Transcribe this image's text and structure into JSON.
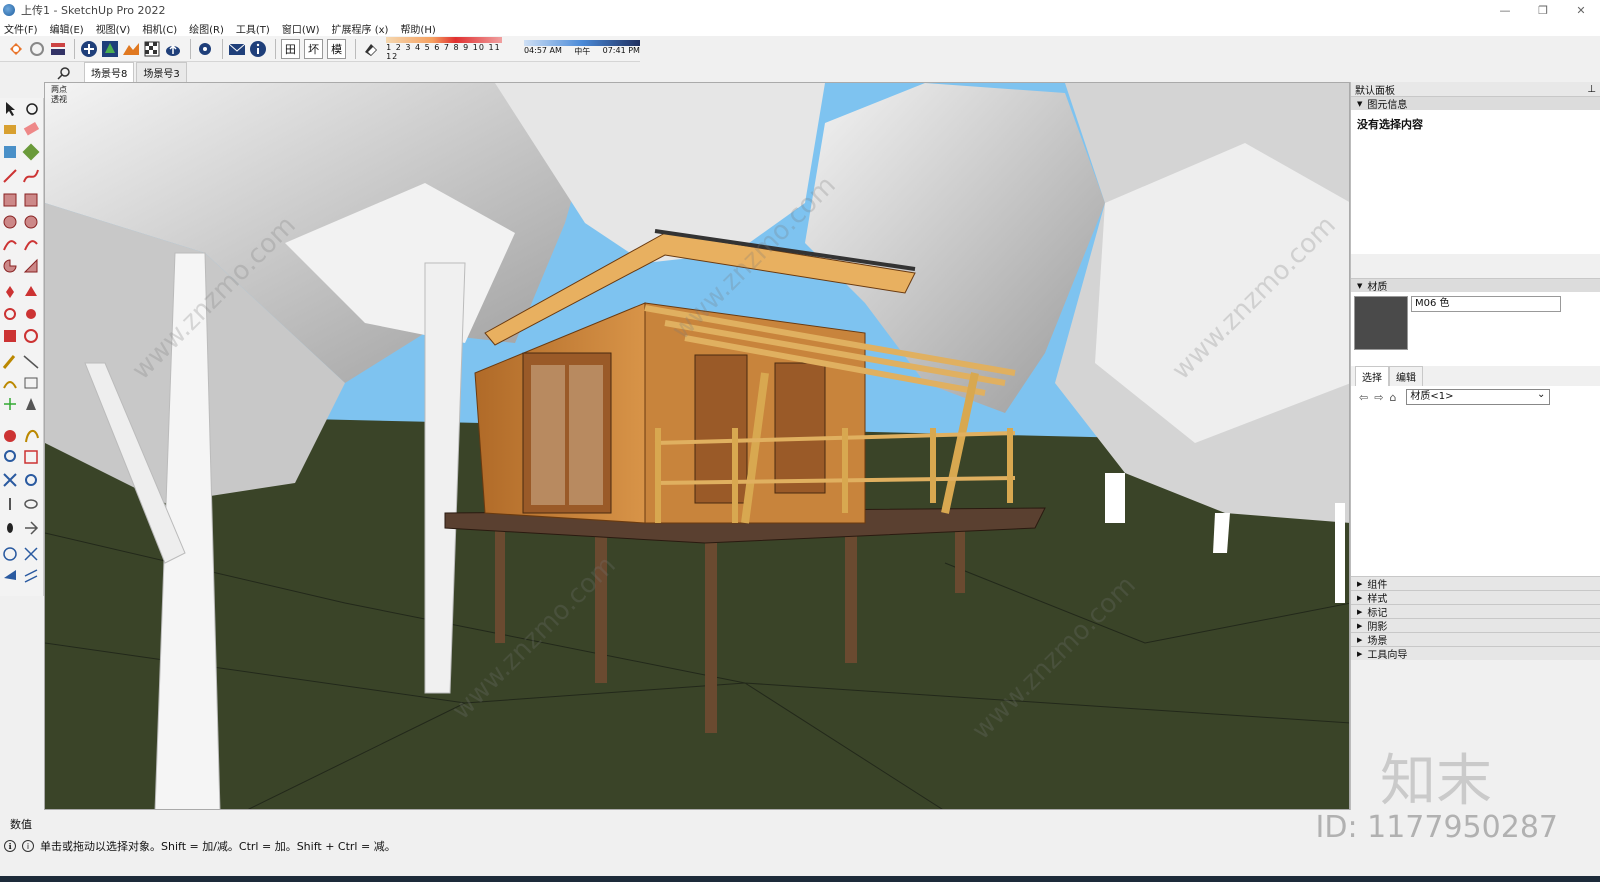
{
  "window": {
    "title": "上传1 - SketchUp Pro 2022",
    "controls": [
      "—",
      "❐",
      "✕"
    ]
  },
  "menu": [
    "文件(F)",
    "编辑(E)",
    "视图(V)",
    "相机(C)",
    "绘图(R)",
    "工具(T)",
    "窗口(W)",
    "扩展程序 (x)",
    "帮助(H)"
  ],
  "toolbar": {
    "text_buttons": [
      "田",
      "坏",
      "模"
    ],
    "months_label": "1 2 3 4 5 6 7 8 9 10 11 12",
    "time_labels": [
      "04:57 AM",
      "中午",
      "07:41 PM"
    ]
  },
  "scene_tabs": [
    "场景号8",
    "场景号3"
  ],
  "viewport": {
    "camera_label_1": "两点",
    "camera_label_2": "透视"
  },
  "tray": {
    "title": "默认面板",
    "pin": "📌",
    "entity_info": {
      "heading": "图元信息",
      "content": "没有选择内容"
    },
    "materials": {
      "heading": "材质",
      "name": "M06 色",
      "tab_select": "选择",
      "tab_edit": "编辑",
      "library": "材质<1>"
    },
    "collapsed_sections": [
      "组件",
      "样式",
      "标记",
      "阴影",
      "场景",
      "工具向导"
    ]
  },
  "status": {
    "vcb_label": "数值",
    "hint": "单击或拖动以选择对象。Shift = 加/减。Ctrl = 加。Shift + Ctrl = 减。"
  },
  "watermark": {
    "site": "www.znzmo.com",
    "brand": "知末网",
    "id_text": "ID: 1177950287",
    "logo": "知末"
  },
  "colors": {
    "sky": "#7ec3f0",
    "ground": "#3a4428",
    "wood": "#c8843c"
  }
}
